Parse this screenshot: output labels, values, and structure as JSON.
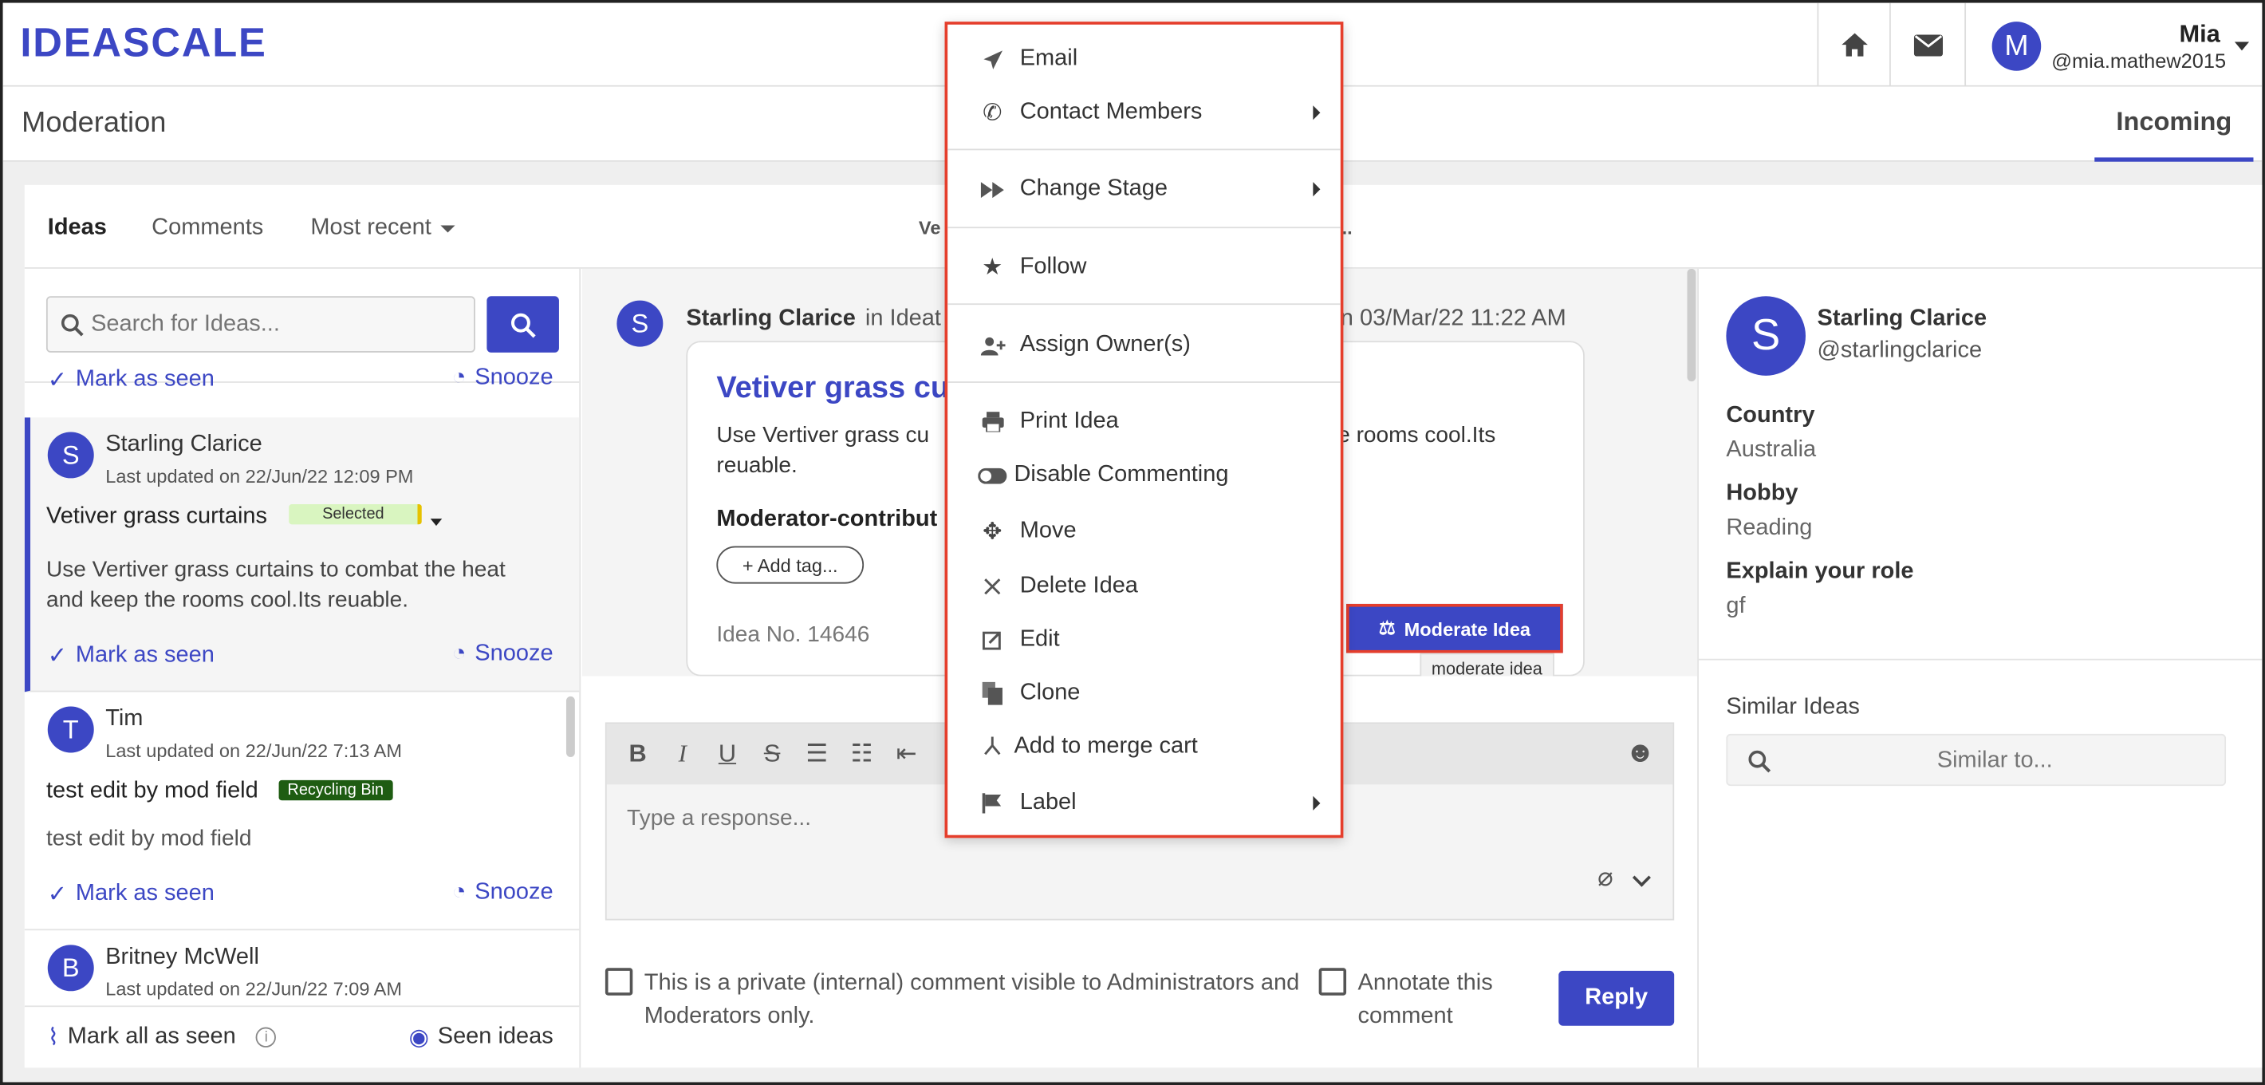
{
  "app": {
    "logo": "IDEASCALE",
    "page_title": "Moderation",
    "active_tab": "Incoming"
  },
  "user": {
    "initial": "M",
    "name": "Mia",
    "handle": "@mia.mathew2015"
  },
  "filters": {
    "ideas": "Ideas",
    "comments": "Comments",
    "sort": "Most recent",
    "partial_title": "Ve",
    "partial_suffix": ".."
  },
  "search": {
    "placeholder": "Search for Ideas..."
  },
  "list": {
    "top_mark": "Mark as seen",
    "top_snooze": "Snooze",
    "items": [
      {
        "initial": "S",
        "name": "Starling Clarice",
        "updated": "Last updated on 22/Jun/22 12:09 PM",
        "title": "Vetiver grass curtains",
        "tag": "Selected",
        "body": "Use Vertiver grass curtains to combat the heat and keep the rooms cool.Its reuable.",
        "mark": "Mark as seen",
        "snooze": "Snooze"
      },
      {
        "initial": "T",
        "name": "Tim",
        "updated": "Last updated on 22/Jun/22 7:13 AM",
        "title": "test edit by mod field",
        "tag": "Recycling Bin",
        "body": "test edit by mod field",
        "mark": "Mark as seen",
        "snooze": "Snooze"
      },
      {
        "initial": "B",
        "name": "Britney McWell",
        "updated": "Last updated on 22/Jun/22 7:09 AM"
      }
    ],
    "footer": {
      "mark_all": "Mark all as seen",
      "seen_ideas": "Seen ideas"
    }
  },
  "idea": {
    "initial": "S",
    "author": "Starling Clarice",
    "in": "in Ideat",
    "date": "n 03/Mar/22 11:22 AM",
    "title": "Vetiver grass cu",
    "body_a": "Use Vertiver grass cu",
    "body_b": "reuable.",
    "body_c": "e rooms cool.Its",
    "moderator_label": "Moderator-contribut",
    "add_tag": "+ Add tag...",
    "idea_no": "Idea No. 14646",
    "moderate_btn": "Moderate Idea",
    "tooltip": "moderate idea"
  },
  "editor": {
    "placeholder": "Type a response...",
    "private_note": "This is a private (internal) comment visible to Administrators and Moderators only.",
    "annotate": "Annotate this comment",
    "reply": "Reply"
  },
  "profile": {
    "initial": "S",
    "name": "Starling Clarice",
    "handle": "@starlingclarice",
    "fields": [
      {
        "label": "Country",
        "value": "Australia"
      },
      {
        "label": "Hobby",
        "value": "Reading"
      },
      {
        "label": "Explain your role",
        "value": "gf"
      }
    ],
    "similar_title": "Similar Ideas",
    "similar_placeholder": "Similar to..."
  },
  "menu": {
    "items": [
      {
        "label": "Email",
        "icon": "send-icon"
      },
      {
        "label": "Contact Members",
        "icon": "phone-icon"
      },
      {
        "label": "Change Stage",
        "icon": "fast-forward-icon"
      },
      {
        "label": "Follow",
        "icon": "star-icon"
      },
      {
        "label": "Assign Owner(s)",
        "icon": "user-plus-icon"
      },
      {
        "label": "Print Idea",
        "icon": "printer-icon"
      },
      {
        "label": "Disable Commenting",
        "icon": "toggle-icon"
      },
      {
        "label": "Move",
        "icon": "move-icon"
      },
      {
        "label": "Delete Idea",
        "icon": "close-icon"
      },
      {
        "label": "Edit",
        "icon": "edit-icon"
      },
      {
        "label": "Clone",
        "icon": "copy-icon"
      },
      {
        "label": "Add to merge cart",
        "icon": "merge-icon"
      },
      {
        "label": "Label",
        "icon": "flag-icon"
      }
    ]
  },
  "colors": {
    "accent": "#3c47c4",
    "menu_border": "#e53e2c",
    "selected_tag": "#d9f5c0",
    "recycle_tag": "#1e5c12"
  }
}
